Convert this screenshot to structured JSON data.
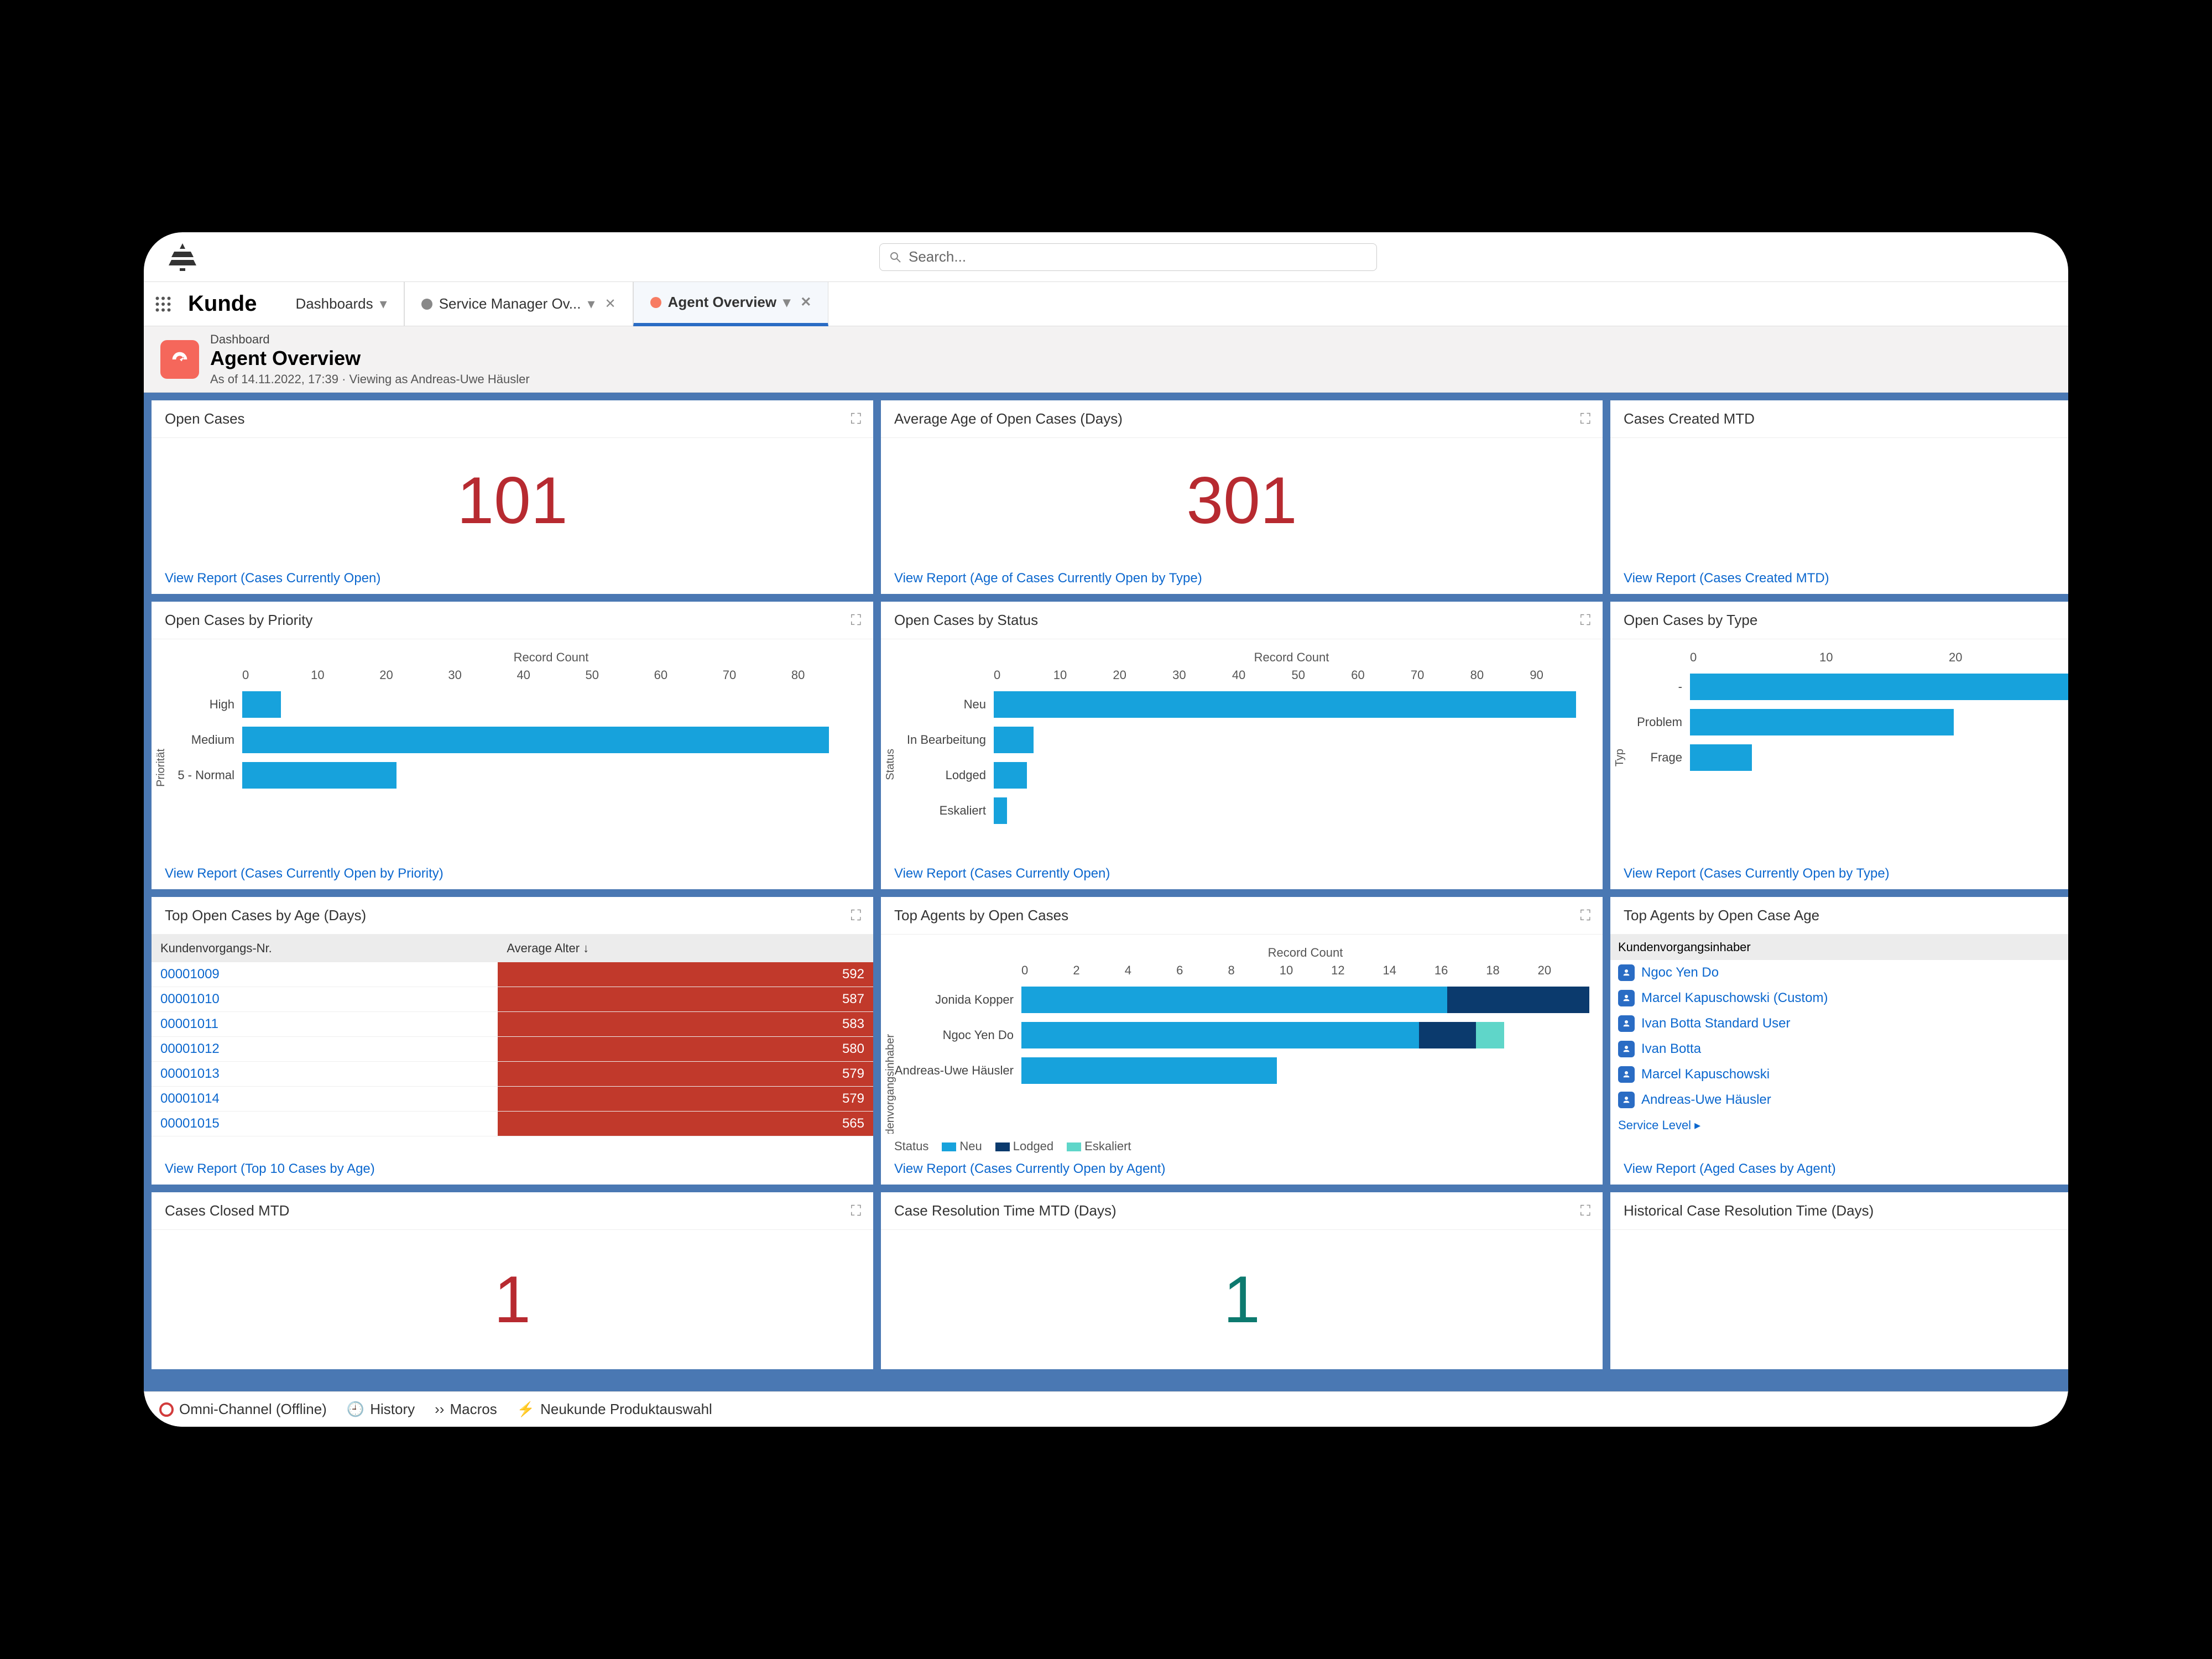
{
  "search_placeholder": "Search...",
  "brand": "Kunde",
  "nav_tabs": {
    "dashboards": "Dashboards",
    "svc_mgr": "Service Manager Ov...",
    "agent_ov": "Agent Overview"
  },
  "subheader": {
    "eyebrow": "Dashboard",
    "title": "Agent Overview",
    "meta": "As of 14.11.2022, 17:39 · Viewing as Andreas-Uwe Häusler"
  },
  "cards": {
    "open_cases": {
      "title": "Open Cases",
      "value": "101",
      "link": "View Report (Cases Currently Open)"
    },
    "avg_age": {
      "title": "Average Age of Open Cases (Days)",
      "value": "301",
      "link": "View Report (Age of Cases Currently Open by Type)"
    },
    "created_mtd": {
      "title": "Cases Created MTD",
      "link": "View Report (Cases Created MTD)"
    },
    "by_priority": {
      "title": "Open Cases by Priority",
      "link": "View Report (Cases Currently Open by Priority)"
    },
    "by_status": {
      "title": "Open Cases by Status",
      "link": "View Report (Cases Currently Open)"
    },
    "by_type": {
      "title": "Open Cases by Type",
      "link": "View Report (Cases Currently Open by Type)"
    },
    "top_age": {
      "title": "Top Open Cases by Age (Days)",
      "link": "View Report (Top 10 Cases by Age)",
      "col1": "Kundenvorgangs-Nr.",
      "col2": "Average Alter ↓"
    },
    "top_agents": {
      "title": "Top Agents by Open Cases",
      "link": "View Report (Cases Currently Open by Agent)",
      "legend_label": "Status",
      "leg_neu": "Neu",
      "leg_lodged": "Lodged",
      "leg_esk": "Eskaliert"
    },
    "agents_age": {
      "title": "Top Agents by Open Case Age",
      "link": "View Report (Aged Cases by Agent)",
      "hdr": "Kundenvorgangsinhaber",
      "srv": "Service Level ▸"
    },
    "closed_mtd": {
      "title": "Cases Closed MTD",
      "value": "1"
    },
    "res_time": {
      "title": "Case Resolution Time MTD (Days)",
      "value": "1"
    },
    "hist_res": {
      "title": "Historical Case Resolution Time (Days)"
    }
  },
  "axis_record_count": "Record Count",
  "y_priority": "Priorität",
  "y_status": "Status",
  "y_type": "Typ",
  "y_owner": "Kundenvorgangsinhaber",
  "agents_list": [
    "Ngoc Yen Do",
    "Marcel Kapuschowski (Custom)",
    "Ivan Botta Standard User",
    "Ivan Botta",
    "Marcel Kapuschowski",
    "Andreas-Uwe Häusler"
  ],
  "footer": {
    "omni": "Omni-Channel (Offline)",
    "history": "History",
    "macros": "Macros",
    "neukunde": "Neukunde Produktauswahl"
  },
  "chart_data": [
    {
      "id": "open_cases_by_priority",
      "type": "bar",
      "orientation": "horizontal",
      "xlabel": "Record Count",
      "ylabel": "Priorität",
      "xlim": [
        0,
        80
      ],
      "xticks": [
        0,
        10,
        20,
        30,
        40,
        50,
        60,
        70,
        80
      ],
      "categories": [
        "High",
        "Medium",
        "5 - Normal"
      ],
      "values": [
        5,
        76,
        20
      ]
    },
    {
      "id": "open_cases_by_status",
      "type": "bar",
      "orientation": "horizontal",
      "xlabel": "Record Count",
      "ylabel": "Status",
      "xlim": [
        0,
        90
      ],
      "xticks": [
        0,
        10,
        20,
        30,
        40,
        50,
        60,
        70,
        80,
        90
      ],
      "categories": [
        "Neu",
        "In Bearbeitung",
        "Lodged",
        "Eskaliert"
      ],
      "values": [
        88,
        6,
        5,
        2
      ]
    },
    {
      "id": "open_cases_by_type",
      "type": "bar",
      "orientation": "horizontal",
      "xlabel": "Record Count",
      "ylabel": "Typ",
      "xlim": [
        0,
        25
      ],
      "xticks": [
        0,
        10,
        20
      ],
      "categories": [
        "-",
        "Problem",
        "Frage"
      ],
      "values": [
        25,
        17,
        4
      ]
    },
    {
      "id": "top_open_cases_by_age",
      "type": "table",
      "columns": [
        "Kundenvorgangs-Nr.",
        "Average Alter"
      ],
      "rows": [
        [
          "00001009",
          592
        ],
        [
          "00001010",
          587
        ],
        [
          "00001011",
          583
        ],
        [
          "00001012",
          580
        ],
        [
          "00001013",
          579
        ],
        [
          "00001014",
          579
        ],
        [
          "00001015",
          565
        ]
      ]
    },
    {
      "id": "top_agents_by_open_cases",
      "type": "bar",
      "orientation": "horizontal",
      "stacked": true,
      "xlabel": "Record Count",
      "ylabel": "Kundenvorgangsinhaber",
      "xlim": [
        0,
        20
      ],
      "xticks": [
        0,
        2,
        4,
        6,
        8,
        10,
        12,
        14,
        16,
        18,
        20
      ],
      "categories": [
        "Jonida Kopper",
        "Ngoc Yen Do",
        "Andreas-Uwe Häusler"
      ],
      "series": [
        {
          "name": "Neu",
          "values": [
            15,
            14,
            9
          ]
        },
        {
          "name": "Lodged",
          "values": [
            5,
            2,
            0
          ]
        },
        {
          "name": "Eskaliert",
          "values": [
            0,
            1,
            0
          ]
        }
      ]
    }
  ]
}
